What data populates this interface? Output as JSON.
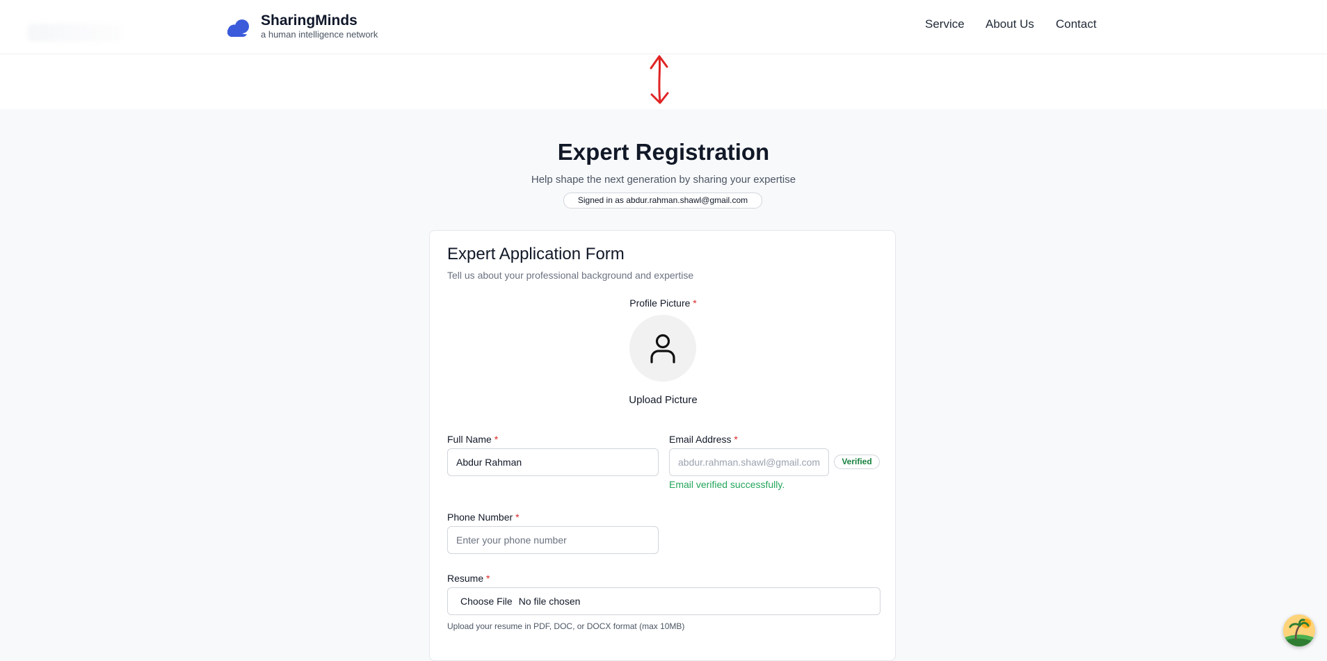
{
  "header": {
    "brand_name": "SharingMinds",
    "brand_tagline": "a human intelligence network",
    "nav": {
      "service": "Service",
      "about": "About Us",
      "contact": "Contact"
    },
    "accent_color": "#3b5bdb"
  },
  "hero": {
    "title": "Expert Registration",
    "subtitle": "Help shape the next generation by sharing your expertise",
    "signed_in": "Signed in as abdur.rahman.shawl@gmail.com"
  },
  "form": {
    "title": "Expert Application Form",
    "description": "Tell us about your professional background and expertise",
    "profile_picture_label": "Profile Picture",
    "upload_picture_label": "Upload Picture",
    "full_name_label": "Full Name",
    "full_name_value": "Abdur Rahman",
    "email_label": "Email Address",
    "email_value": "abdur.rahman.shawl@gmail.com",
    "verified_badge": "Verified",
    "email_status": "Email verified successfully.",
    "phone_label": "Phone Number",
    "phone_placeholder": "Enter your phone number",
    "resume_label": "Resume",
    "choose_file": "Choose File",
    "no_file": "No file chosen",
    "resume_help": "Upload your resume in PDF, DOC, or DOCX format (max 10MB)",
    "required_mark": "*"
  },
  "icons": {
    "brand": "logo-cloud-icon",
    "avatar": "user-icon",
    "annotation": "double-arrow-icon",
    "floating": "assistant-avatar-icon"
  }
}
